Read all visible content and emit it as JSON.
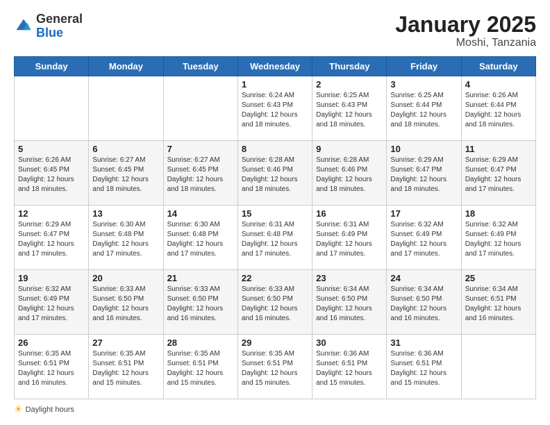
{
  "header": {
    "logo_general": "General",
    "logo_blue": "Blue",
    "month": "January 2025",
    "location": "Moshi, Tanzania"
  },
  "footer": {
    "label": "Daylight hours"
  },
  "days_of_week": [
    "Sunday",
    "Monday",
    "Tuesday",
    "Wednesday",
    "Thursday",
    "Friday",
    "Saturday"
  ],
  "weeks": [
    [
      {
        "day": "",
        "info": ""
      },
      {
        "day": "",
        "info": ""
      },
      {
        "day": "",
        "info": ""
      },
      {
        "day": "1",
        "info": "Sunrise: 6:24 AM\nSunset: 6:43 PM\nDaylight: 12 hours\nand 18 minutes."
      },
      {
        "day": "2",
        "info": "Sunrise: 6:25 AM\nSunset: 6:43 PM\nDaylight: 12 hours\nand 18 minutes."
      },
      {
        "day": "3",
        "info": "Sunrise: 6:25 AM\nSunset: 6:44 PM\nDaylight: 12 hours\nand 18 minutes."
      },
      {
        "day": "4",
        "info": "Sunrise: 6:26 AM\nSunset: 6:44 PM\nDaylight: 12 hours\nand 18 minutes."
      }
    ],
    [
      {
        "day": "5",
        "info": "Sunrise: 6:26 AM\nSunset: 6:45 PM\nDaylight: 12 hours\nand 18 minutes."
      },
      {
        "day": "6",
        "info": "Sunrise: 6:27 AM\nSunset: 6:45 PM\nDaylight: 12 hours\nand 18 minutes."
      },
      {
        "day": "7",
        "info": "Sunrise: 6:27 AM\nSunset: 6:45 PM\nDaylight: 12 hours\nand 18 minutes."
      },
      {
        "day": "8",
        "info": "Sunrise: 6:28 AM\nSunset: 6:46 PM\nDaylight: 12 hours\nand 18 minutes."
      },
      {
        "day": "9",
        "info": "Sunrise: 6:28 AM\nSunset: 6:46 PM\nDaylight: 12 hours\nand 18 minutes."
      },
      {
        "day": "10",
        "info": "Sunrise: 6:29 AM\nSunset: 6:47 PM\nDaylight: 12 hours\nand 18 minutes."
      },
      {
        "day": "11",
        "info": "Sunrise: 6:29 AM\nSunset: 6:47 PM\nDaylight: 12 hours\nand 17 minutes."
      }
    ],
    [
      {
        "day": "12",
        "info": "Sunrise: 6:29 AM\nSunset: 6:47 PM\nDaylight: 12 hours\nand 17 minutes."
      },
      {
        "day": "13",
        "info": "Sunrise: 6:30 AM\nSunset: 6:48 PM\nDaylight: 12 hours\nand 17 minutes."
      },
      {
        "day": "14",
        "info": "Sunrise: 6:30 AM\nSunset: 6:48 PM\nDaylight: 12 hours\nand 17 minutes."
      },
      {
        "day": "15",
        "info": "Sunrise: 6:31 AM\nSunset: 6:48 PM\nDaylight: 12 hours\nand 17 minutes."
      },
      {
        "day": "16",
        "info": "Sunrise: 6:31 AM\nSunset: 6:49 PM\nDaylight: 12 hours\nand 17 minutes."
      },
      {
        "day": "17",
        "info": "Sunrise: 6:32 AM\nSunset: 6:49 PM\nDaylight: 12 hours\nand 17 minutes."
      },
      {
        "day": "18",
        "info": "Sunrise: 6:32 AM\nSunset: 6:49 PM\nDaylight: 12 hours\nand 17 minutes."
      }
    ],
    [
      {
        "day": "19",
        "info": "Sunrise: 6:32 AM\nSunset: 6:49 PM\nDaylight: 12 hours\nand 17 minutes."
      },
      {
        "day": "20",
        "info": "Sunrise: 6:33 AM\nSunset: 6:50 PM\nDaylight: 12 hours\nand 16 minutes."
      },
      {
        "day": "21",
        "info": "Sunrise: 6:33 AM\nSunset: 6:50 PM\nDaylight: 12 hours\nand 16 minutes."
      },
      {
        "day": "22",
        "info": "Sunrise: 6:33 AM\nSunset: 6:50 PM\nDaylight: 12 hours\nand 16 minutes."
      },
      {
        "day": "23",
        "info": "Sunrise: 6:34 AM\nSunset: 6:50 PM\nDaylight: 12 hours\nand 16 minutes."
      },
      {
        "day": "24",
        "info": "Sunrise: 6:34 AM\nSunset: 6:50 PM\nDaylight: 12 hours\nand 16 minutes."
      },
      {
        "day": "25",
        "info": "Sunrise: 6:34 AM\nSunset: 6:51 PM\nDaylight: 12 hours\nand 16 minutes."
      }
    ],
    [
      {
        "day": "26",
        "info": "Sunrise: 6:35 AM\nSunset: 6:51 PM\nDaylight: 12 hours\nand 16 minutes."
      },
      {
        "day": "27",
        "info": "Sunrise: 6:35 AM\nSunset: 6:51 PM\nDaylight: 12 hours\nand 15 minutes."
      },
      {
        "day": "28",
        "info": "Sunrise: 6:35 AM\nSunset: 6:51 PM\nDaylight: 12 hours\nand 15 minutes."
      },
      {
        "day": "29",
        "info": "Sunrise: 6:35 AM\nSunset: 6:51 PM\nDaylight: 12 hours\nand 15 minutes."
      },
      {
        "day": "30",
        "info": "Sunrise: 6:36 AM\nSunset: 6:51 PM\nDaylight: 12 hours\nand 15 minutes."
      },
      {
        "day": "31",
        "info": "Sunrise: 6:36 AM\nSunset: 6:51 PM\nDaylight: 12 hours\nand 15 minutes."
      },
      {
        "day": "",
        "info": ""
      }
    ]
  ]
}
